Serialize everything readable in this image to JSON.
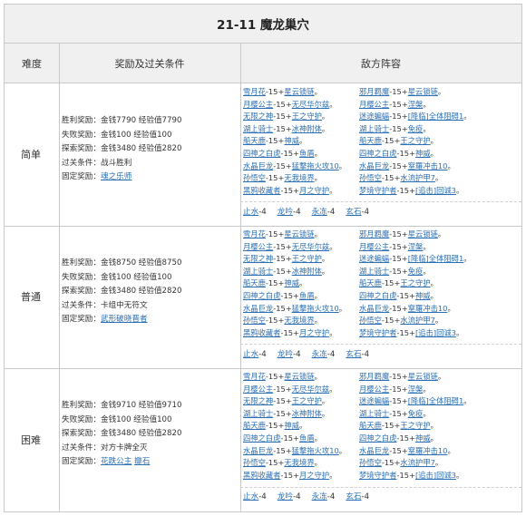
{
  "title": "21-11 魔龙巢穴",
  "headers": {
    "difficulty": "难度",
    "rewards": "奖励及过关条件",
    "enemies": "敌方阵容"
  },
  "levels": [
    {
      "difficulty": "简单",
      "rewards": [
        {
          "label": "胜利奖励：",
          "value": "金钱7790 经验值7790"
        },
        {
          "label": "失败奖励：",
          "value": "金钱100 经验值100"
        },
        {
          "label": "探索奖励：",
          "value": "金钱3480 经验值2820"
        },
        {
          "label": "过关条件：",
          "value": "战斗胜利"
        },
        {
          "label": "固定奖励：",
          "value": "魂之乐师",
          "link": true
        }
      ],
      "enemies_left": [
        [
          "雪月花",
          "-15+",
          "星云锁链",
          "。"
        ],
        [
          "月樱公主",
          "-15+",
          "无尽华尔兹",
          "。"
        ],
        [
          "无限之神",
          "-15+",
          "王之守护",
          "。"
        ],
        [
          "湖上骑士",
          "-15+",
          "冰神附体",
          "。"
        ],
        [
          "船天鹿",
          "-15+",
          "神威",
          "。"
        ],
        [
          "四神之白虎",
          "-15+",
          "鱼盾",
          "。"
        ],
        [
          "水晶巨龙",
          "-15+",
          "猛撃拖火攻10",
          "。"
        ],
        [
          "孙悟空",
          "-15+",
          "无我境界",
          "。"
        ],
        [
          "黑鸦收藏者",
          "-15+",
          "月之守护",
          "。"
        ]
      ],
      "enemies_right": [
        [
          "邪月羁魔",
          "-15+",
          "星云锁链",
          "。"
        ],
        [
          "月樱公主",
          "-15+",
          "涅槃",
          "。"
        ],
        [
          "迷途蝙蝠",
          "-15+",
          "[降临]全体阻碍1",
          "。"
        ],
        [
          "湖上骑士",
          "-15+",
          "免疫",
          "。"
        ],
        [
          "船天鹿",
          "-15+",
          "王之守护",
          "。"
        ],
        [
          "四神之白虎",
          "-15+",
          "神威",
          "。"
        ],
        [
          "水晶巨龙",
          "-15+",
          "窒羅冲击10",
          "。"
        ],
        [
          "孙悟空",
          "-15+",
          "水流护甲7",
          "。"
        ],
        [
          "梦境守护者",
          "-15+",
          "[追击]回诚3",
          "。"
        ]
      ],
      "elements": [
        {
          "name": "止水",
          "num": "-4"
        },
        {
          "name": "龙吟",
          "num": "-4"
        },
        {
          "name": "永冻",
          "num": "-4"
        },
        {
          "name": "玄石",
          "num": "-4"
        }
      ]
    },
    {
      "difficulty": "普通",
      "rewards": [
        {
          "label": "胜利奖励：",
          "value": "金钱8750 经验值8750"
        },
        {
          "label": "失败奖励：",
          "value": "金钱100 经验值100"
        },
        {
          "label": "探索奖励：",
          "value": "金钱3480 经验值2820"
        },
        {
          "label": "过关条件：",
          "value": "卡组中无符文"
        },
        {
          "label": "固定奖励：",
          "value": "武形破晓晋者",
          "link": true
        }
      ],
      "enemies_left": [
        [
          "雪月花",
          "-15+",
          "星云锁链",
          "。"
        ],
        [
          "月樱公主",
          "-15+",
          "无尽华尔兹",
          "。"
        ],
        [
          "无限之神",
          "-15+",
          "王之守护",
          "。"
        ],
        [
          "湖上骑士",
          "-15+",
          "冰神附体",
          "。"
        ],
        [
          "船天鹿",
          "-15+",
          "神威",
          "。"
        ],
        [
          "四神之白虎",
          "-15+",
          "鱼盾",
          "。"
        ],
        [
          "水晶巨龙",
          "-15+",
          "猛撃拖火攻10",
          "。"
        ],
        [
          "孙悟空",
          "-15+",
          "无我境界",
          "。"
        ],
        [
          "黑鸦收藏者",
          "-15+",
          "月之守护",
          "。"
        ]
      ],
      "enemies_right": [
        [
          "邪月羁魔",
          "-15+",
          "星云锁链",
          "。"
        ],
        [
          "月樱公主",
          "-15+",
          "涅槃",
          "。"
        ],
        [
          "迷途蝙蝠",
          "-15+",
          "[降临]全体阻碍1",
          "。"
        ],
        [
          "湖上骑士",
          "-15+",
          "免疫",
          "。"
        ],
        [
          "船天鹿",
          "-15+",
          "王之守护",
          "。"
        ],
        [
          "四神之白虎",
          "-15+",
          "神威",
          "。"
        ],
        [
          "水晶巨龙",
          "-15+",
          "窒羅冲击10",
          "。"
        ],
        [
          "孙悟空",
          "-15+",
          "水流护甲7",
          "。"
        ],
        [
          "梦境守护者",
          "-15+",
          "[追击]回诚3",
          "。"
        ]
      ],
      "elements": [
        {
          "name": "止水",
          "num": "-4"
        },
        {
          "name": "龙吟",
          "num": "-4"
        },
        {
          "name": "永冻",
          "num": "-4"
        },
        {
          "name": "玄石",
          "num": "-4"
        }
      ]
    },
    {
      "difficulty": "困难",
      "rewards": [
        {
          "label": "胜利奖励：",
          "value": "金钱9710 经验值9710"
        },
        {
          "label": "失败奖励：",
          "value": "金钱100 经验值100"
        },
        {
          "label": "探索奖励：",
          "value": "金钱3480 经验值2820"
        },
        {
          "label": "过关条件：",
          "value": "对方卡牌全灭"
        },
        {
          "label": "固定奖励：",
          "value": "花跌公主",
          "link": true,
          "extra": "瓣石"
        }
      ],
      "enemies_left": [
        [
          "雪月花",
          "-15+",
          "星云锁链",
          "。"
        ],
        [
          "月樱公主",
          "-15+",
          "无尽华尔兹",
          "。"
        ],
        [
          "无限之神",
          "-15+",
          "王之守护",
          "。"
        ],
        [
          "湖上骑士",
          "-15+",
          "冰神附体",
          "。"
        ],
        [
          "船天鹿",
          "-15+",
          "神威",
          "。"
        ],
        [
          "四神之白虎",
          "-15+",
          "鱼盾",
          "。"
        ],
        [
          "水晶巨龙",
          "-15+",
          "猛撃拖火攻10",
          "。"
        ],
        [
          "孙悟空",
          "-15+",
          "无我境界",
          "。"
        ],
        [
          "黑鸦收藏者",
          "-15+",
          "月之守护",
          "。"
        ]
      ],
      "enemies_right": [
        [
          "邪月羁魔",
          "-15+",
          "星云锁链",
          "。"
        ],
        [
          "月樱公主",
          "-15+",
          "涅槃",
          "。"
        ],
        [
          "迷途蝙蝠",
          "-15+",
          "[降临]全体阻碍1",
          "。"
        ],
        [
          "湖上骑士",
          "-15+",
          "免疫",
          "。"
        ],
        [
          "船天鹿",
          "-15+",
          "王之守护",
          "。"
        ],
        [
          "四神之白虎",
          "-15+",
          "神威",
          "。"
        ],
        [
          "水晶巨龙",
          "-15+",
          "窒羅冲击10",
          "。"
        ],
        [
          "孙悟空",
          "-15+",
          "水流护甲7",
          "。"
        ],
        [
          "梦境守护者",
          "-15+",
          "[追击]回诚3",
          "。"
        ]
      ],
      "elements": [
        {
          "name": "止水",
          "num": "-4"
        },
        {
          "name": "龙吟",
          "num": "-4"
        },
        {
          "name": "永冻",
          "num": "-4"
        },
        {
          "name": "玄石",
          "num": "-4"
        }
      ]
    }
  ]
}
